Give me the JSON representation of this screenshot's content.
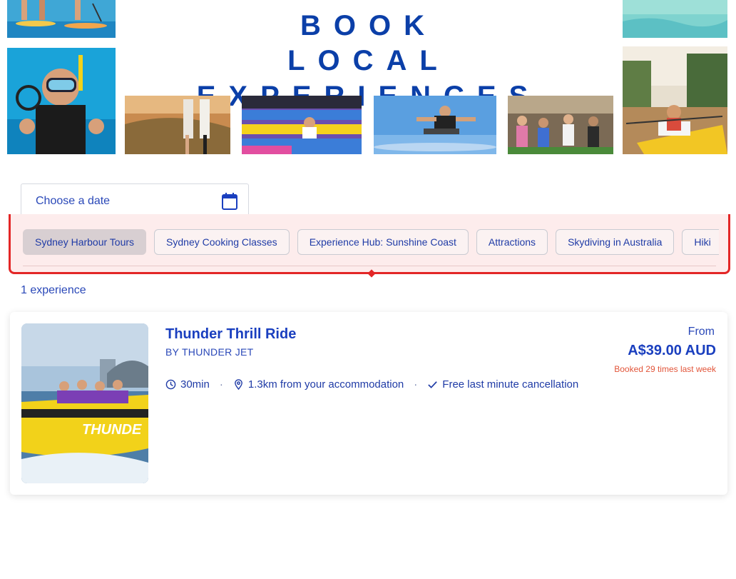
{
  "banner": {
    "headline_line1": "BOOK",
    "headline_line2": "LOCAL EXPERIENCES"
  },
  "date_picker": {
    "placeholder": "Choose a date",
    "icon": "calendar-icon"
  },
  "categories": {
    "items": [
      {
        "label": "Sydney Harbour Tours",
        "active": true
      },
      {
        "label": "Sydney Cooking Classes",
        "active": false
      },
      {
        "label": "Experience Hub: Sunshine Coast",
        "active": false
      },
      {
        "label": "Attractions",
        "active": false
      },
      {
        "label": "Skydiving in Australia",
        "active": false
      },
      {
        "label": "Hiki",
        "active": false
      }
    ]
  },
  "results": {
    "count_text": "1 experience"
  },
  "experience": {
    "title": "Thunder Thrill Ride",
    "by": "BY THUNDER JET",
    "duration": "30min",
    "distance": "1.3km from your accommodation",
    "cancellation": "Free last minute cancellation",
    "from_label": "From",
    "price": "A$39.00 AUD",
    "booked": "Booked 29 times last week"
  },
  "colors": {
    "brand_blue": "#0b3fa8",
    "link_blue": "#1a3fbf",
    "highlight_red": "#e32626",
    "booked_orange": "#e2553a"
  }
}
